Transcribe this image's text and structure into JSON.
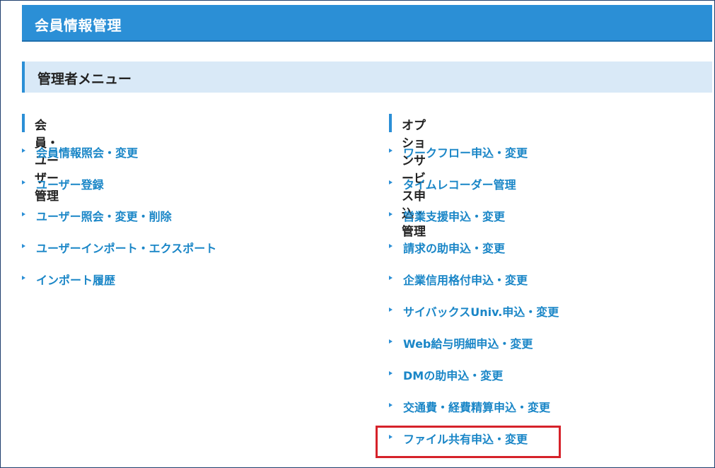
{
  "header": {
    "title": "会員情報管理"
  },
  "menu": {
    "title": "管理者メニュー"
  },
  "left_column": {
    "heading": "会員・ユーザー管理",
    "items": [
      {
        "label": "会員情報照会・変更"
      },
      {
        "label": "ユーザー登録"
      },
      {
        "label": "ユーザー照会・変更・削除"
      },
      {
        "label": "ユーザーインポート・エクスポート"
      },
      {
        "label": "インポート履歴"
      }
    ]
  },
  "right_column": {
    "heading": "オプションサービス申込・管理",
    "items": [
      {
        "label": "ワークフロー申込・変更"
      },
      {
        "label": "タイムレコーダー管理"
      },
      {
        "label": "営業支援申込・変更"
      },
      {
        "label": "請求の助申込・変更"
      },
      {
        "label": "企業信用格付申込・変更"
      },
      {
        "label": "サイバックスUniv.申込・変更"
      },
      {
        "label": "Web給与明細申込・変更"
      },
      {
        "label": "DMの助申込・変更"
      },
      {
        "label": "交通費・経費精算申込・変更"
      },
      {
        "label": "ファイル共有申込・変更"
      }
    ]
  },
  "colors": {
    "header_bg": "#2b8fd6",
    "menu_band_bg": "#d9e9f7",
    "link": "#1a86c7",
    "highlight_border": "#d6222a"
  }
}
